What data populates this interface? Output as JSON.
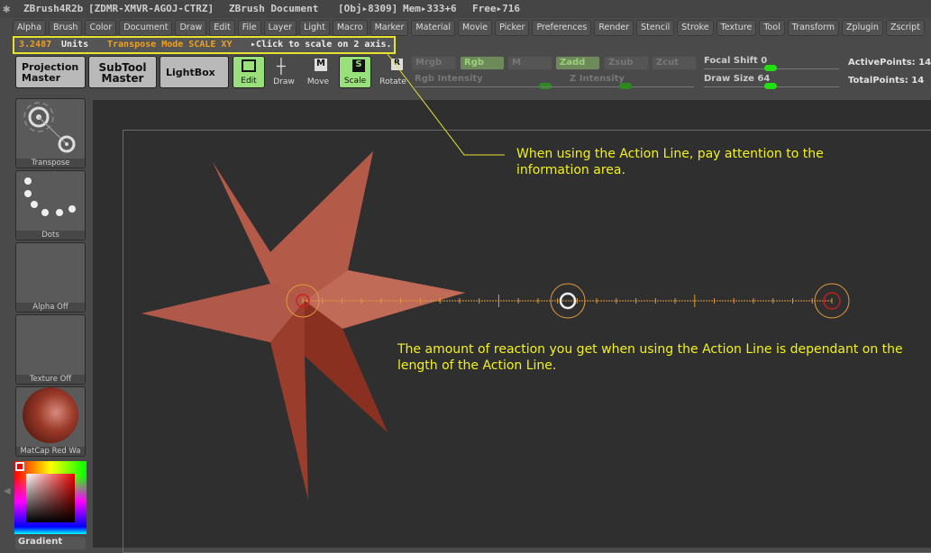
{
  "titlebar": {
    "app": "ZBrush4R2b",
    "license": "[ZDMR-XMVR-AGOJ-CTRZ]",
    "document": "ZBrush Document",
    "obj": "[Obj▸8309]",
    "mem": "Mem▸333+6",
    "free": "Free▸716"
  },
  "menu": [
    "Alpha",
    "Brush",
    "Color",
    "Document",
    "Draw",
    "Edit",
    "File",
    "Layer",
    "Light",
    "Macro",
    "Marker",
    "Material",
    "Movie",
    "Picker",
    "Preferences",
    "Render",
    "Stencil",
    "Stroke",
    "Texture",
    "Tool",
    "Transform",
    "Zplugin",
    "Zscript"
  ],
  "info": {
    "value": "3.2487",
    "units": "Units",
    "mode": "Transpose Mode SCALE XY",
    "hint": "▸Click to scale on 2 axis."
  },
  "toolbar": {
    "projection": [
      "Projection",
      "Master"
    ],
    "subtool": [
      "SubTool",
      "Master"
    ],
    "lightbox": "LightBox",
    "edit": "Edit",
    "draw": "Draw",
    "move": "Move",
    "scale": "Scale",
    "rotate": "Rotate",
    "mrgb": "Mrgb",
    "rgb": "Rgb",
    "m": "M",
    "zadd": "Zadd",
    "zsub": "Zsub",
    "zcut": "Zcut",
    "rgb_intensity": "Rgb Intensity",
    "z_intensity": "Z Intensity",
    "focal_shift": "Focal Shift 0",
    "draw_size": "Draw Size 64",
    "active_points": "ActivePoints: 14",
    "total_points": "TotalPoints: 14"
  },
  "left": {
    "transpose": "Transpose",
    "dots": "Dots",
    "alpha": "Alpha Off",
    "texture": "Texture Off",
    "matcap": "MatCap Red Wa",
    "gradient": "Gradient"
  },
  "notes": {
    "top": "When using the Action Line, pay attention to the information area.",
    "bottom": "The amount of reaction you get when using the Action Line is dependant on the length of the Action Line."
  },
  "colors": {
    "accent": "#e7e230",
    "active": "#9ae07a",
    "star": "#a0402e",
    "action_line": "#e39a3a"
  }
}
